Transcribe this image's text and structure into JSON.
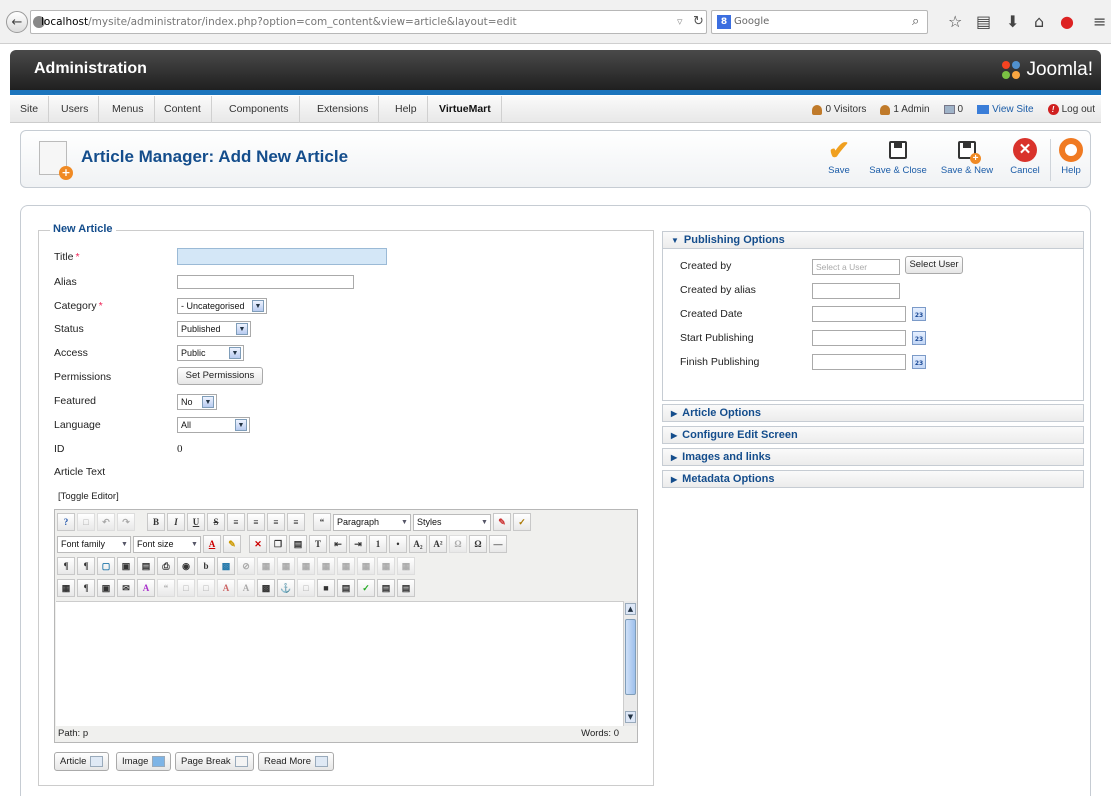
{
  "browser": {
    "url_host": "localhost",
    "url_rest": "/mysite/administrator/index.php?option=com_content&view=article&layout=edit",
    "search_engine": "Google",
    "search_badge": "8"
  },
  "header": {
    "title": "Administration",
    "logo_text": "Joomla!"
  },
  "menu": {
    "items": [
      "Site",
      "Users",
      "Menus",
      "Content",
      "Components",
      "Extensions",
      "Help",
      "VirtueMart"
    ]
  },
  "status": {
    "visitors": "0 Visitors",
    "admins": "1 Admin",
    "messages": "0",
    "view_site": "View Site",
    "logout": "Log out"
  },
  "toolbar": {
    "page_title": "Article Manager: Add New Article",
    "buttons": [
      "Save",
      "Save & Close",
      "Save & New",
      "Cancel",
      "Help"
    ]
  },
  "form": {
    "legend": "New Article",
    "labels": {
      "title": "Title",
      "alias": "Alias",
      "category": "Category",
      "status": "Status",
      "access": "Access",
      "permissions": "Permissions",
      "featured": "Featured",
      "language": "Language",
      "id": "ID",
      "article_text": "Article Text"
    },
    "required_mark": "*",
    "values": {
      "category": "- Uncategorised",
      "status": "Published",
      "access": "Public",
      "featured": "No",
      "language": "All",
      "id": "0"
    },
    "set_permissions_label": "Set Permissions",
    "toggle_editor": "[Toggle Editor]"
  },
  "editor": {
    "format_select": "Paragraph",
    "styles_select": "Styles",
    "font_family": "Font family",
    "font_size": "Font size",
    "path": "Path: p",
    "words": "Words: 0"
  },
  "editor_buttons": [
    "Article",
    "Image",
    "Page Break",
    "Read More"
  ],
  "publishing": {
    "header": "Publishing Options",
    "labels": [
      "Created by",
      "Created by alias",
      "Created Date",
      "Start Publishing",
      "Finish Publishing"
    ],
    "created_by_placeholder": "Select a User",
    "select_user_label": "Select User",
    "calendar_label": "23"
  },
  "accordion": {
    "sections": [
      "Article Options",
      "Configure Edit Screen",
      "Images and links",
      "Metadata Options"
    ]
  }
}
